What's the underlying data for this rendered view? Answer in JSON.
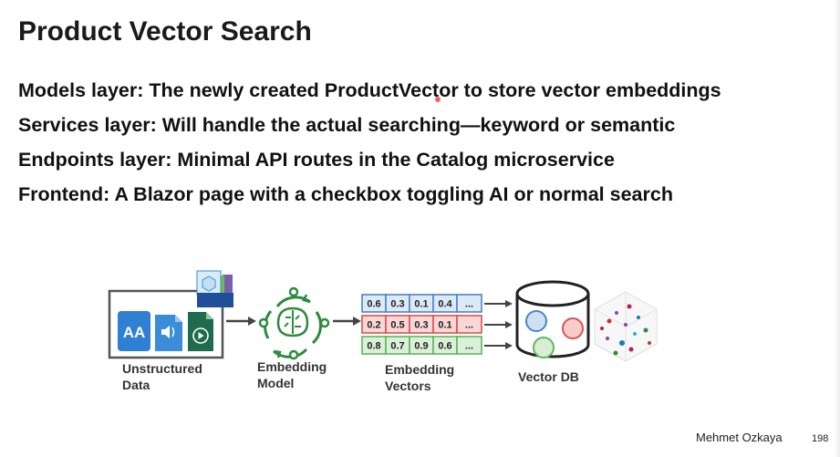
{
  "slide": {
    "title": "Product Vector Search",
    "bullets": [
      "Models layer: The newly created ProductVector to store vector embeddings",
      "Services layer: Will handle the actual searching—keyword or semantic",
      "Endpoints layer: Minimal API routes in the Catalog microservice",
      "Frontend: A Blazor page with a checkbox toggling AI or normal search"
    ],
    "author": "Mehmet Ozkaya",
    "page_number": "198"
  },
  "diagram": {
    "unstructured": {
      "line1": "Unstructured",
      "line2": "Data",
      "text_icon_label": "AA"
    },
    "model": {
      "line1": "Embedding",
      "line2": "Model"
    },
    "vectors": {
      "line1": "Embedding",
      "line2": "Vectors",
      "rows": [
        {
          "cells": [
            "0.6",
            "0.3",
            "0.1",
            "0.4",
            "..."
          ],
          "color": "#4a86c5",
          "fill": "#dce9f6"
        },
        {
          "cells": [
            "0.2",
            "0.5",
            "0.3",
            "0.1",
            "..."
          ],
          "color": "#d9534f",
          "fill": "#f8d7d6"
        },
        {
          "cells": [
            "0.8",
            "0.7",
            "0.9",
            "0.6",
            "..."
          ],
          "color": "#5cb85c",
          "fill": "#dcefd8"
        }
      ]
    },
    "db": {
      "label": "Vector DB"
    },
    "colors": {
      "accent_green": "#2e8b3e",
      "doc_blue": "#2f7fd3",
      "audio_blue": "#3a8dd6",
      "video_green": "#1f6b4f"
    }
  }
}
